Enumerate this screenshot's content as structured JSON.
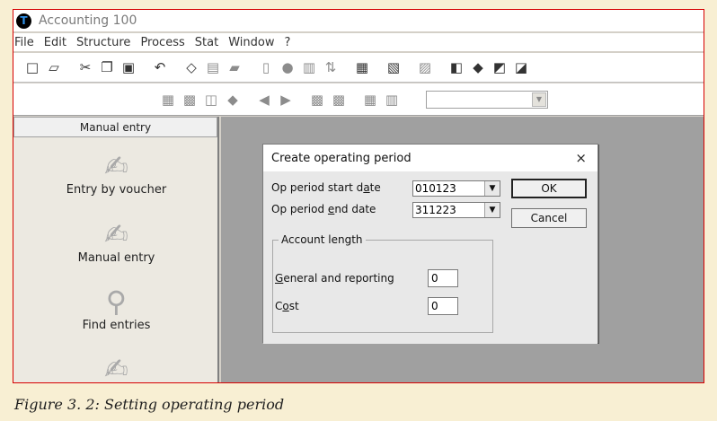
{
  "window": {
    "icon_letter": "T",
    "title": "Accounting 100"
  },
  "menu": [
    "File",
    "Edit",
    "Structure",
    "Process",
    "Stat",
    "Window",
    "?"
  ],
  "left_panel": {
    "header": "Manual entry",
    "items": [
      {
        "label": "Entry by voucher",
        "icon": "hand-pen-icon"
      },
      {
        "label": "Manual entry",
        "icon": "hand-pen-icon"
      },
      {
        "label": "Find entries",
        "icon": "find-icon"
      },
      {
        "label": "",
        "icon": "hand-pen-icon"
      }
    ]
  },
  "dialog": {
    "title": "Create operating period",
    "close_glyph": "×",
    "start_label_pre": "Op period start d",
    "start_label_u": "a",
    "start_label_post": "te",
    "start_value": "010123",
    "end_label_pre": "Op period ",
    "end_label_u": "e",
    "end_label_post": "nd date",
    "end_value": "311223",
    "ok_label": "OK",
    "cancel_label": "Cancel",
    "group_title": "Account length",
    "general_label_u": "G",
    "general_label_post": "eneral and reporting",
    "general_value": "0",
    "cost_label_pre": "C",
    "cost_label_u": "o",
    "cost_label_post": "st",
    "cost_value": "0"
  },
  "caption": "Figure 3. 2: Setting operating period",
  "colors": {
    "page_background": "#f8efd3",
    "frame_border": "#d60000",
    "mdi_background": "#a0a0a0"
  }
}
